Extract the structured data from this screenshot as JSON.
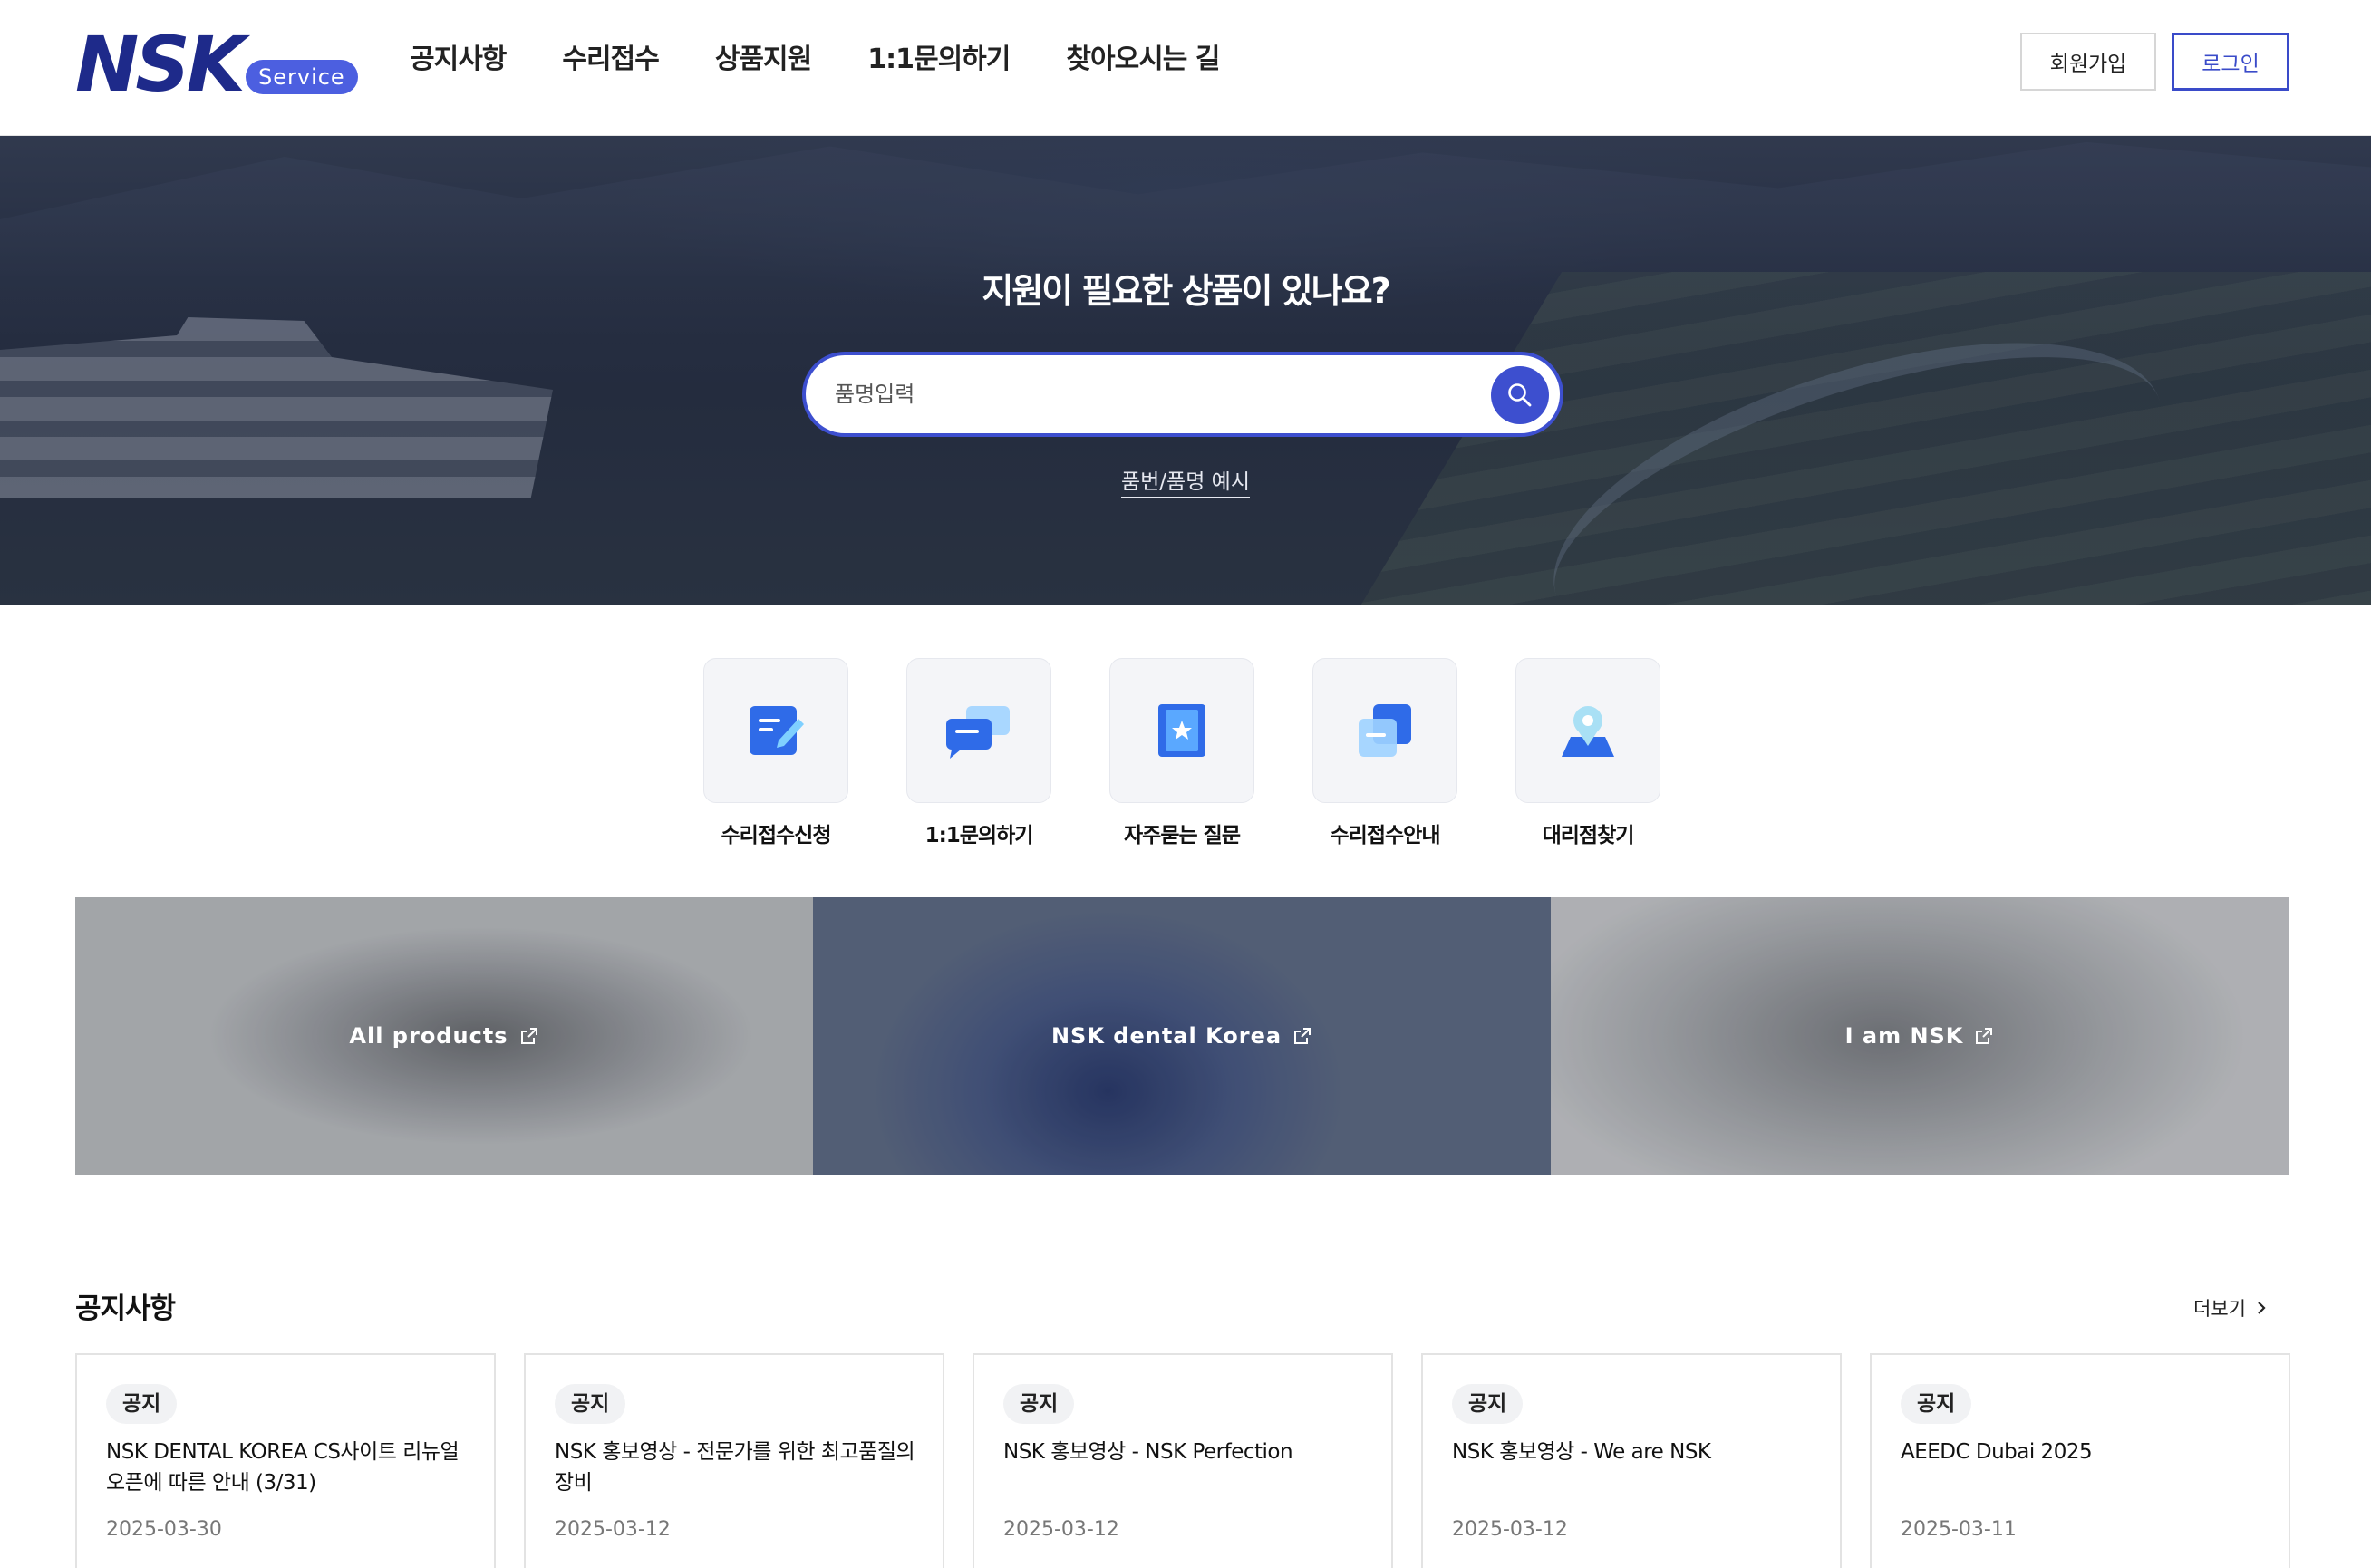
{
  "header": {
    "logo_text": "NSK",
    "logo_badge": "Service",
    "nav": [
      "공지사항",
      "수리접수",
      "상품지원",
      "1:1문의하기",
      "찾아오시는 길"
    ],
    "join_label": "회원가입",
    "login_label": "로그인"
  },
  "hero": {
    "title": "지원이 필요한 상품이 있나요?",
    "search_placeholder": "품명입력",
    "example_link": "품번/품명 예시"
  },
  "quick_menu": [
    {
      "label": "수리접수신청",
      "icon": "edit-form-icon"
    },
    {
      "label": "1:1문의하기",
      "icon": "chat-bubbles-icon"
    },
    {
      "label": "자주묻는 질문",
      "icon": "bookmark-star-icon"
    },
    {
      "label": "수리접수안내",
      "icon": "copy-documents-icon"
    },
    {
      "label": "대리점찾기",
      "icon": "map-pin-icon"
    }
  ],
  "banners": [
    {
      "label": "All products"
    },
    {
      "label": "NSK dental Korea"
    },
    {
      "label": "I am NSK"
    }
  ],
  "notices": {
    "heading": "공지사항",
    "more_label": "더보기",
    "items": [
      {
        "badge": "공지",
        "title": "NSK DENTAL KOREA CS사이트 리뉴얼 오픈에 따른 안내 (3/31)",
        "date": "2025-03-30"
      },
      {
        "badge": "공지",
        "title": "NSK 홍보영상 - 전문가를 위한 최고품질의 장비",
        "date": "2025-03-12"
      },
      {
        "badge": "공지",
        "title": "NSK 홍보영상 - NSK Perfection",
        "date": "2025-03-12"
      },
      {
        "badge": "공지",
        "title": "NSK 홍보영상 - We are NSK",
        "date": "2025-03-12"
      },
      {
        "badge": "공지",
        "title": "AEEDC Dubai 2025",
        "date": "2025-03-11"
      }
    ]
  },
  "colors": {
    "brand_navy": "#1e2a8a",
    "accent_blue": "#3d4fcf",
    "badge_blue": "#4c5fe0"
  }
}
